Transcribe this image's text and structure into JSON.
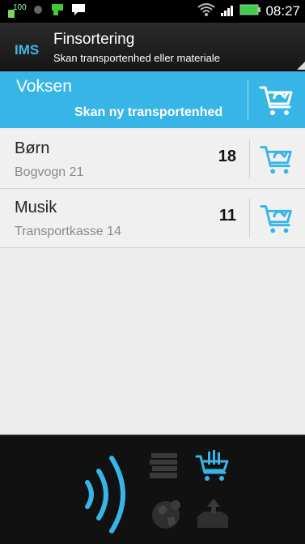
{
  "status_bar": {
    "battery_level": "100",
    "time": "08:27"
  },
  "header": {
    "logo": "IMS",
    "title": "Finsortering",
    "subtitle": "Skan transportenhed eller materiale"
  },
  "active": {
    "name": "Voksen",
    "action": "Skan ny transportenhed"
  },
  "rows": [
    {
      "title": "Børn",
      "subtitle": "Bogvogn 21",
      "count": "18"
    },
    {
      "title": "Musik",
      "subtitle": "Transportkasse 14",
      "count": "11"
    }
  ],
  "colors": {
    "accent": "#37b5e7",
    "header_bg": "#1f1f1f",
    "list_bg": "#f0f0f0",
    "bottom_bg": "#111111"
  },
  "icons": {
    "row_action": "cart-refresh-icon",
    "bottom": [
      "nfc-icon",
      "books-icon",
      "cart-icon",
      "globe-icon",
      "inbox-icon"
    ]
  }
}
